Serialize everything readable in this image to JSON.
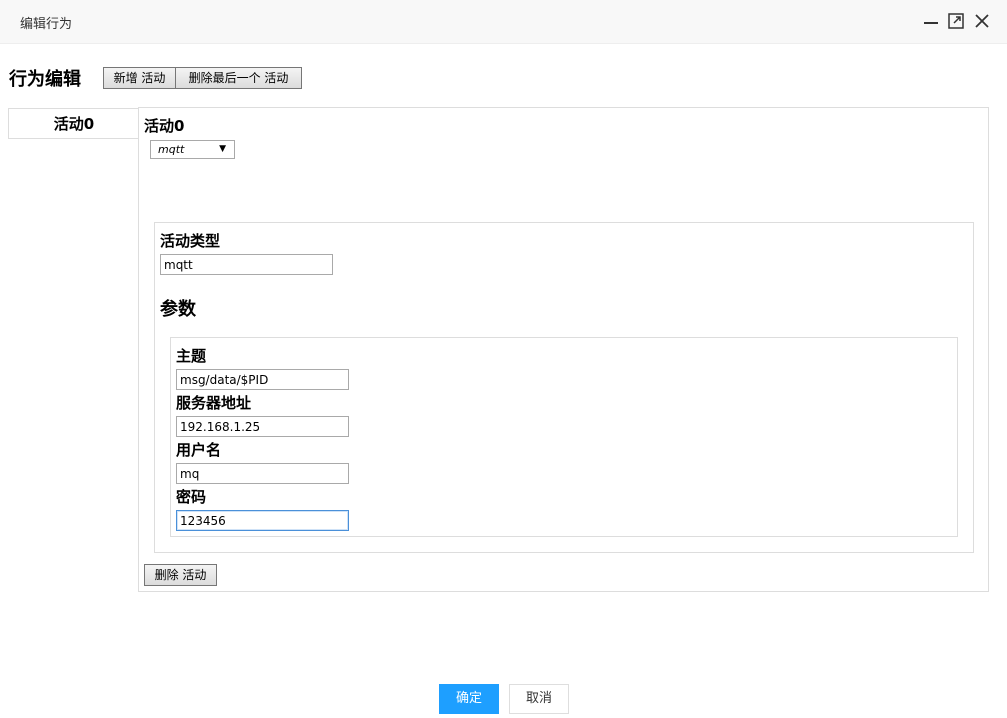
{
  "window": {
    "title": "编辑行为",
    "minimize_icon": "minimize-icon",
    "maximize_icon": "maximize-icon",
    "close_icon": "close-icon"
  },
  "header": {
    "title": "行为编辑",
    "add_label": "新增 活动",
    "delete_last_label": "删除最后一个 活动"
  },
  "tabs": [
    {
      "label": "活动0"
    }
  ],
  "activity": {
    "title": "活动0",
    "select_value": "mqtt",
    "type_label": "活动类型",
    "type_value": "mqtt",
    "params_title": "参数",
    "params": {
      "topic_label": "主题",
      "topic_value": "msg/data/$PID",
      "server_label": "服务器地址",
      "server_value": "192.168.1.25",
      "user_label": "用户名",
      "user_value": "mq",
      "password_label": "密码",
      "password_value": "123456"
    },
    "delete_label": "删除 活动"
  },
  "footer": {
    "ok_label": "确定",
    "cancel_label": "取消"
  },
  "colors": {
    "primary": "#1e9fff",
    "titlebar_bg": "#f8f8f8"
  }
}
